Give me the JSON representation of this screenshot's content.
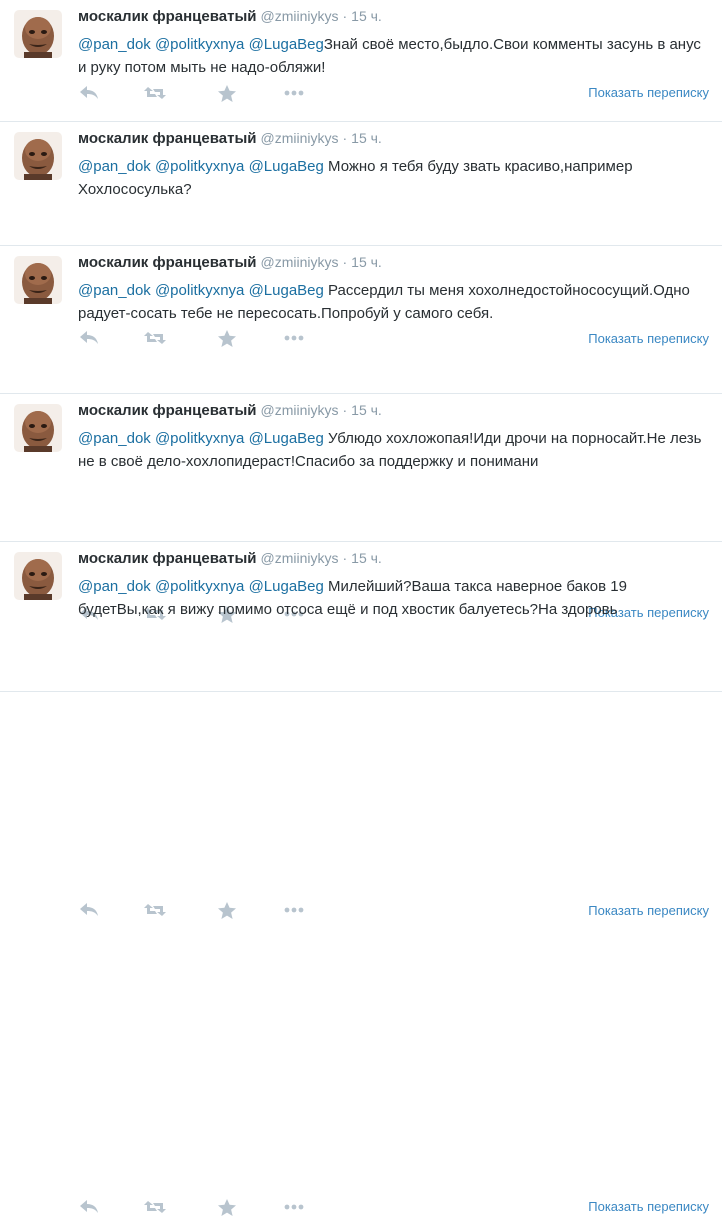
{
  "tweets": [
    {
      "author": "москалик францеватый",
      "handle": "@zmiiniykys",
      "time": "15 ч.",
      "mentions": [
        "@pan_dok",
        "@politkyxnya",
        "@LugaBeg"
      ],
      "text": "Знай своё место,быдло.Свои комменты засунь в анус и руку потом мыть не надо-обляжи!",
      "view_conversation": "Показать переписку"
    },
    {
      "author": "москалик францеватый",
      "handle": "@zmiiniykys",
      "time": "15 ч.",
      "mentions": [
        "@pan_dok",
        "@politkyxnya",
        "@LugaBeg"
      ],
      "text": "Можно я тебя буду звать красиво,например Хохлососулька?",
      "view_conversation": "Показать переписку"
    },
    {
      "author": "москалик францеватый",
      "handle": "@zmiiniykys",
      "time": "15 ч.",
      "mentions": [
        "@pan_dok",
        "@politkyxnya",
        "@LugaBeg"
      ],
      "text": "Рассердил ты меня хохолнедостойнососущий.Одно радует-сосать тебе не пересосать.Попробуй у самого себя.",
      "view_conversation": "Показать переписку"
    },
    {
      "author": "москалик францеватый",
      "handle": "@zmiiniykys",
      "time": "15 ч.",
      "mentions": [
        "@pan_dok",
        "@politkyxnya",
        "@LugaBeg"
      ],
      "text": "Ублюдо хохложопая!Иди дрочи на порносайт.Не лезь не в своё дело-хохлопидераст!Спасибо за поддержку и понимани",
      "view_conversation": "Показать переписку"
    },
    {
      "author": "москалик францеватый",
      "handle": "@zmiiniykys",
      "time": "15 ч.",
      "mentions": [
        "@pan_dok",
        "@politkyxnya",
        "@LugaBeg"
      ],
      "text": "Милейший?Ваша такса наверное баков 19 будетВы,как я вижу помимо отсоса ещё и под хвостик балуетесь?На здоровь",
      "view_conversation": "Показать переписку"
    }
  ]
}
